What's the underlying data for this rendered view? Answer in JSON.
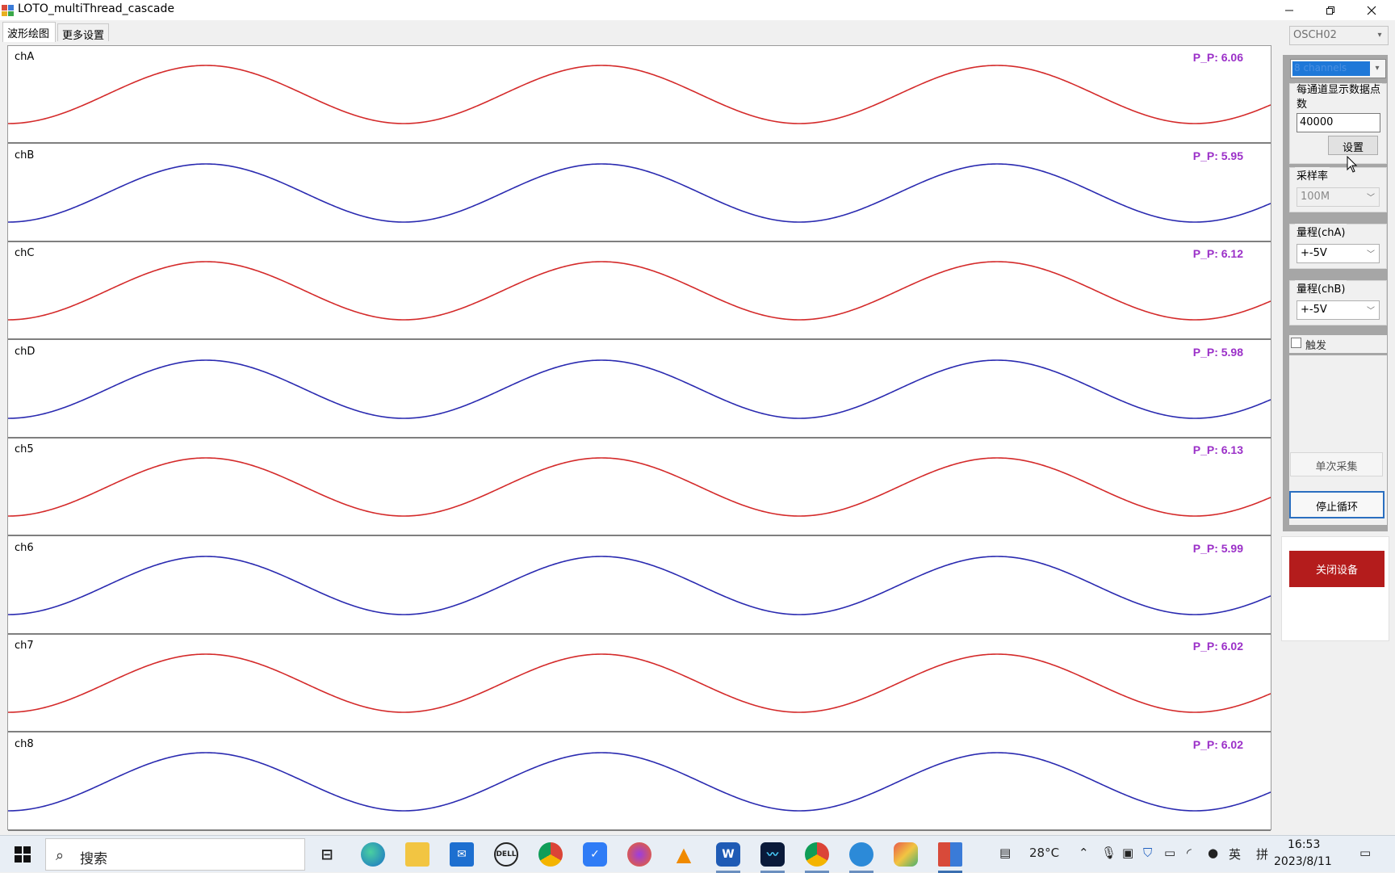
{
  "window": {
    "title": "LOTO_multiThread_cascade"
  },
  "tabs": [
    {
      "label": "波形绘图"
    },
    {
      "label": "更多设置"
    }
  ],
  "plots": [
    {
      "label": "chA",
      "pp": "P_P: 6.06",
      "color": "#d42a2a"
    },
    {
      "label": "chB",
      "pp": "P_P: 5.95",
      "color": "#2a2ab0"
    },
    {
      "label": "chC",
      "pp": "P_P: 6.12",
      "color": "#d42a2a"
    },
    {
      "label": "chD",
      "pp": "P_P: 5.98",
      "color": "#2a2ab0"
    },
    {
      "label": "ch5",
      "pp": "P_P: 6.13",
      "color": "#d42a2a"
    },
    {
      "label": "ch6",
      "pp": "P_P: 5.99",
      "color": "#2a2ab0"
    },
    {
      "label": "ch7",
      "pp": "P_P: 6.02",
      "color": "#d42a2a"
    },
    {
      "label": "ch8",
      "pp": "P_P: 6.02",
      "color": "#2a2ab0"
    }
  ],
  "panel": {
    "device": "OSCH02",
    "channels": "8 channels",
    "points_title": "每通道显示数据点数",
    "points_value": "40000",
    "set_label": "设置",
    "rate_title": "采样率",
    "rate_value": "100M",
    "rangeA_title": "量程(chA)",
    "rangeA_value": "+-5V",
    "rangeB_title": "量程(chB)",
    "rangeB_value": "+-5V",
    "trigger_label": "触发",
    "single_label": "单次采集",
    "loop_label": "停止循环",
    "close_label": "关闭设备",
    "close_color": "#b41c1c"
  },
  "taskbar": {
    "search_placeholder": "搜索",
    "weather": "28°C",
    "ime_lang": "英",
    "ime_mode": "拼",
    "time": "16:53",
    "date": "2023/8/11",
    "dell_label": "DELL",
    "word_label": "W"
  }
}
